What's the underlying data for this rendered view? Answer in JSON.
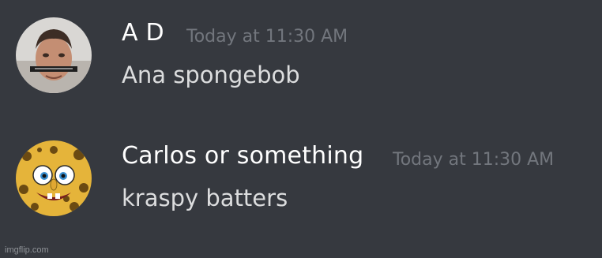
{
  "messages": [
    {
      "username": "A D",
      "timestamp": "Today at 11:30 AM",
      "content": "Ana spongebob",
      "avatar_icon": "user-photo-avatar"
    },
    {
      "username": "Carlos or something",
      "timestamp": "Today at 11:30 AM",
      "content": "kraspy batters",
      "avatar_icon": "spongebob-avatar"
    }
  ],
  "watermark": "imgflip.com",
  "colors": {
    "background": "#36393f",
    "username": "#ffffff",
    "timestamp": "#72767d",
    "message_text": "#dcddde"
  }
}
